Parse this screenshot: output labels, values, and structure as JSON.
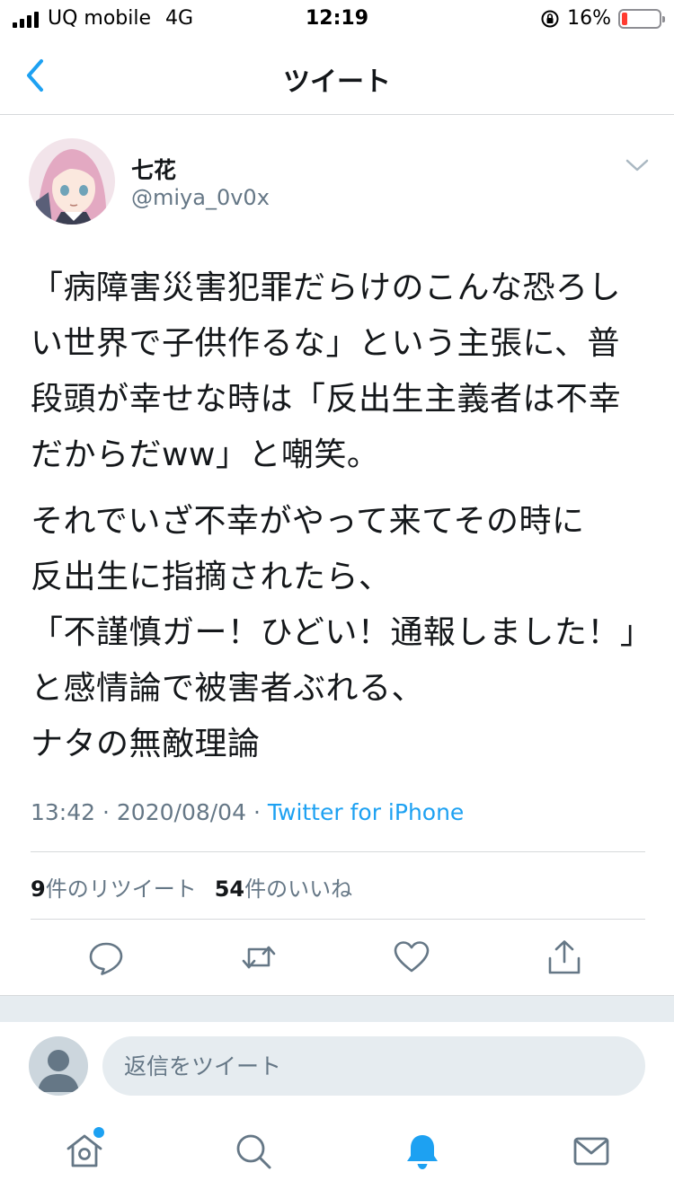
{
  "status_bar": {
    "carrier": "UQ mobile",
    "network": "4G",
    "time": "12:19",
    "battery_percent": "16%",
    "battery_level": 0.16
  },
  "nav": {
    "title": "ツイート"
  },
  "tweet": {
    "user_name": "七花",
    "user_handle": "@miya_0v0x",
    "paragraphs": [
      "「病障害災害犯罪だらけのこんな恐ろしい世界で子供作るな」という主張に、普段頭が幸せな時は「反出生主義者は不幸だからだww」と嘲笑。",
      "それでいざ不幸がやって来てその時に\n反出生に指摘されたら、\n「不謹慎ガー！ひどい！通報しました！」と感情論で被害者ぶれる、\nナタの無敵理論"
    ],
    "time": "13:42",
    "date": "2020/08/04",
    "separator": "·",
    "source": "Twitter for iPhone",
    "retweet_count": "9",
    "retweet_label": "件のリツイート",
    "like_count": "54",
    "like_label": "件のいいね"
  },
  "reply": {
    "placeholder": "返信をツイート"
  },
  "colors": {
    "accent": "#1da1f2",
    "secondary_text": "#657786",
    "divider": "#d6d9db",
    "battery_low": "#ff3b30"
  },
  "icons": {
    "back": "chevron-left-icon",
    "more": "chevron-down-icon",
    "reply": "comment-icon",
    "retweet": "retweet-icon",
    "like": "heart-icon",
    "share": "share-icon",
    "home": "home-icon",
    "search": "search-icon",
    "notifications": "bell-icon",
    "messages": "mail-icon"
  }
}
